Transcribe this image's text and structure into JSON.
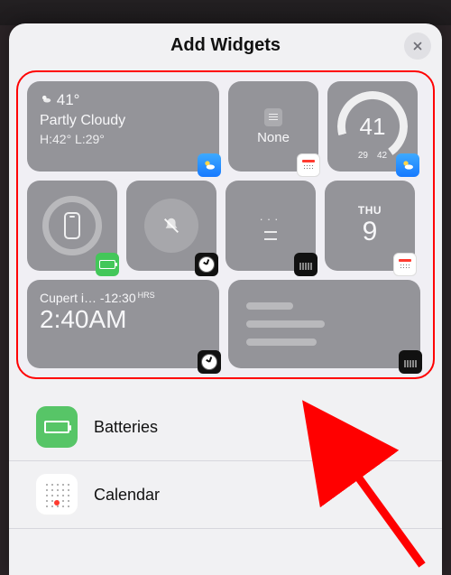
{
  "header": {
    "title": "Add Widgets"
  },
  "widgets": {
    "weather": {
      "temp": "41°",
      "condition": "Partly Cloudy",
      "hilow": "H:42° L:29°"
    },
    "calendar_none": {
      "label": "None"
    },
    "gauge": {
      "value": "41",
      "left": "29",
      "right": "42"
    },
    "day": {
      "dow": "THU",
      "num": "9"
    },
    "clock": {
      "city": "Cupert i…",
      "offset": "-12:30",
      "unit": "HRS",
      "time": "2:40AM"
    }
  },
  "list": [
    {
      "id": "batteries",
      "label": "Batteries"
    },
    {
      "id": "calendar",
      "label": "Calendar"
    }
  ]
}
